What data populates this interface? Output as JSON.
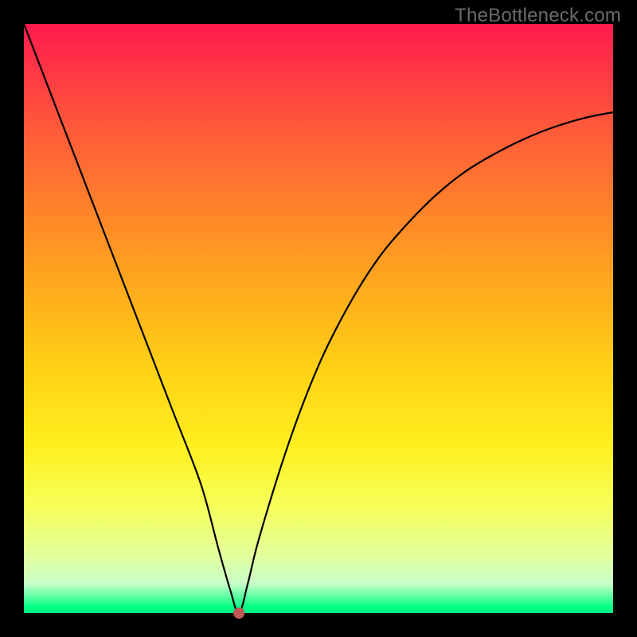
{
  "watermark": "TheBottleneck.com",
  "chart_data": {
    "type": "line",
    "title": "",
    "xlabel": "",
    "ylabel": "",
    "xlim": [
      0,
      100
    ],
    "ylim": [
      0,
      100
    ],
    "grid": false,
    "legend": false,
    "background_gradient": [
      "#ff1a4d",
      "#ff8429",
      "#ffd515",
      "#fff020",
      "#00ff84"
    ],
    "series": [
      {
        "name": "bottleneck-curve",
        "x": [
          0,
          5,
          10,
          15,
          20,
          25,
          30,
          33,
          35,
          36.5,
          38,
          40,
          45,
          50,
          55,
          60,
          65,
          70,
          75,
          80,
          85,
          90,
          95,
          100
        ],
        "values": [
          100,
          87,
          74,
          61,
          48,
          35,
          22,
          11,
          4,
          0,
          5,
          13,
          29,
          42,
          52,
          60,
          66,
          71,
          75,
          78,
          80.5,
          82.5,
          84,
          85
        ]
      }
    ],
    "marker": {
      "x": 36.5,
      "y": 0,
      "color": "#c05858"
    }
  }
}
